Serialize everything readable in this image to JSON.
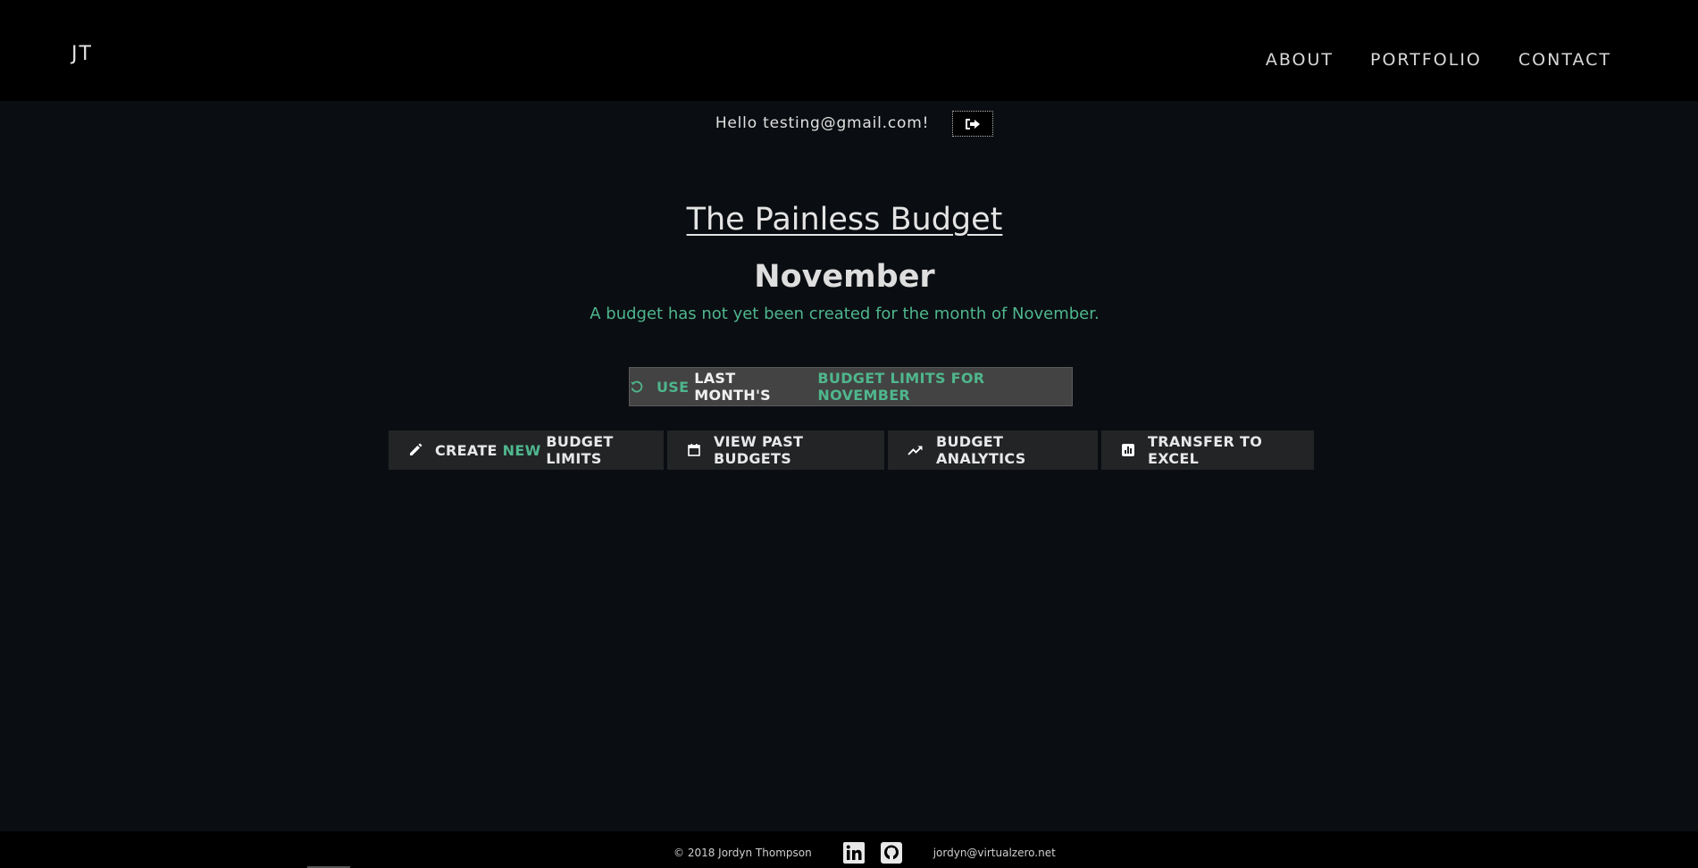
{
  "nav": {
    "brand": "JT",
    "links": [
      "ABOUT",
      "PORTFOLIO",
      "CONTACT"
    ]
  },
  "greeting": {
    "text": "Hello testing@gmail.com!",
    "logout_icon": "sign-out-icon"
  },
  "main": {
    "title": "The Painless Budget",
    "month": "November",
    "notice": "A budget has not yet been created for the month of November.",
    "reuse_button": {
      "icon": "refresh-icon",
      "part1": "USE",
      "part2": "LAST MONTH'S",
      "part3": "BUDGET LIMITS FOR NOVEMBER"
    },
    "actions": {
      "create": {
        "icon": "pencil-icon",
        "pre": "CREATE",
        "highlight": "NEW",
        "post": "BUDGET LIMITS"
      },
      "past": {
        "icon": "calendar-icon",
        "label": "VIEW PAST BUDGETS"
      },
      "analytics": {
        "icon": "trending-up-icon",
        "label": "BUDGET ANALYTICS"
      },
      "excel": {
        "icon": "bar-chart-icon",
        "label": "TRANSFER TO EXCEL"
      }
    }
  },
  "footer": {
    "copyright": "© 2018 Jordyn Thompson",
    "email": "jordyn@virtualzero.net",
    "icons": [
      "linkedin-icon",
      "github-icon"
    ]
  },
  "colors": {
    "accent": "#4fb68d",
    "background": "#0a0d11",
    "topbar": "#000000"
  }
}
